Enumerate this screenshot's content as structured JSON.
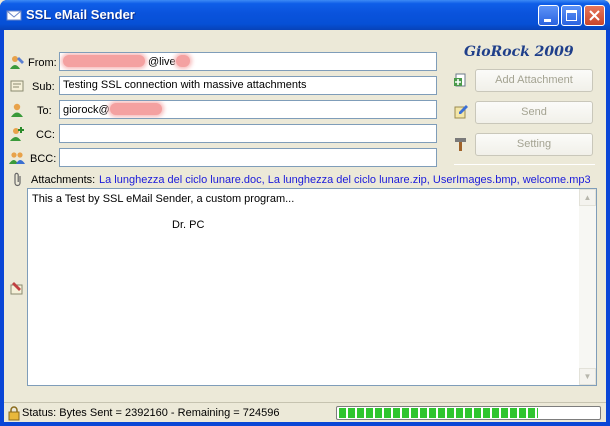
{
  "window": {
    "title": "SSL eMail Sender"
  },
  "brand": "GioRock 2009",
  "fields": {
    "from": {
      "label": "From:",
      "value": "@live"
    },
    "subject": {
      "label": "Sub:",
      "value": "Testing SSL connection with massive attachments"
    },
    "to": {
      "label": "To:",
      "value": "giorock@"
    },
    "cc": {
      "label": "CC:",
      "value": ""
    },
    "bcc": {
      "label": "BCC:",
      "value": ""
    }
  },
  "buttons": {
    "add_attachment": "Add Attachment",
    "send": "Send",
    "setting": "Setting"
  },
  "attachments": {
    "label": "Attachments:",
    "files": "La lunghezza del ciclo lunare.doc, La lunghezza del ciclo lunare.zip, UserImages.bmp, welcome.mp3"
  },
  "body": {
    "line1": "This a Test by SSL eMail Sender, a custom program...",
    "line2": "Dr. PC"
  },
  "status": {
    "text": "Status: Bytes Sent = 2392160 - Remaining = 724596",
    "progress_fraction": 0.77
  },
  "icons": [
    "email-icon",
    "from-user-icon",
    "subject-icon",
    "to-user-icon",
    "cc-user-add-icon",
    "bcc-users-icon",
    "paperclip-icon",
    "attach-file-icon",
    "send-pen-icon",
    "hammer-icon",
    "body-edit-icon",
    "lock-icon"
  ]
}
